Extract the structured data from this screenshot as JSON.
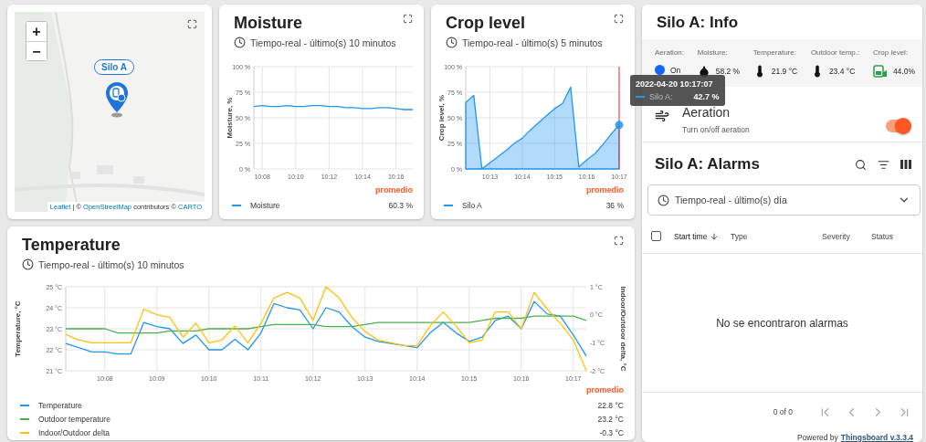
{
  "map": {
    "zoom_in": "+",
    "zoom_out": "−",
    "marker_label": "Silo A",
    "attribution": [
      {
        "text": "Leaflet",
        "link": true
      },
      {
        "text": " | © ",
        "link": false
      },
      {
        "text": "OpenStreetMap",
        "link": true
      },
      {
        "text": " contributors © ",
        "link": false
      },
      {
        "text": "CARTO",
        "link": true
      }
    ]
  },
  "moisture": {
    "title": "Moisture",
    "timewindow": "Tiempo-real - último(s) 10 minutos",
    "legend_header": "promedio",
    "chart_data": {
      "type": "line",
      "grid": true,
      "ylabel": "Moisture, %",
      "ylim": [
        0,
        100
      ],
      "categories": [
        null,
        "10:08",
        null,
        null,
        null,
        "10:10",
        null,
        null,
        null,
        "10:12",
        null,
        null,
        null,
        "10:14",
        null,
        null,
        null,
        "10:16",
        null,
        null
      ],
      "series": [
        {
          "name": "Moisture",
          "color": "#2196f3",
          "values": [
            61,
            62,
            61,
            61,
            62,
            61,
            61,
            62,
            62,
            61,
            61,
            60,
            60,
            59,
            59,
            60,
            60,
            59,
            58,
            58
          ]
        }
      ],
      "yticks": [
        {
          "value": 0,
          "label": "0 %"
        },
        {
          "value": 25,
          "label": "25 %"
        },
        {
          "value": 50,
          "label": "50 %"
        },
        {
          "value": 75,
          "label": "75 %"
        },
        {
          "value": 100,
          "label": "100 %"
        }
      ]
    },
    "legend": [
      {
        "value": "60.3 %"
      }
    ]
  },
  "crop": {
    "title": "Crop level",
    "timewindow": "Tiempo-real - último(s) 5 minutos",
    "legend_header": "promedio",
    "chart_data": {
      "type": "area",
      "grid": true,
      "ylabel": "Crop level, %",
      "ylim": [
        0,
        100
      ],
      "categories": [
        null,
        null,
        null,
        "10:13",
        null,
        null,
        null,
        "10:14",
        null,
        null,
        null,
        "10:15",
        null,
        null,
        null,
        "10:16",
        null,
        null,
        null,
        "10:17"
      ],
      "series": [
        {
          "name": "Silo A",
          "color": "#2196f3",
          "values": [
            65,
            72,
            0,
            6,
            12,
            18,
            25,
            30,
            38,
            45,
            52,
            59,
            64,
            80,
            2,
            9,
            15,
            24,
            34,
            43
          ]
        }
      ],
      "yticks": [
        {
          "value": 0,
          "label": "0 %"
        },
        {
          "value": 25,
          "label": "25 %"
        },
        {
          "value": 50,
          "label": "50 %"
        },
        {
          "value": 75,
          "label": "75 %"
        },
        {
          "value": 100,
          "label": "100 %"
        }
      ]
    },
    "tooltip": {
      "time": "2022-04-20 10:17:07",
      "series": "Silo A:",
      "value": "42.7 %",
      "color": "#2196f3"
    },
    "legend": [
      {
        "value": "36 %"
      }
    ]
  },
  "temperature": {
    "title": "Temperature",
    "timewindow": "Tiempo-real - último(s) 10 minutos",
    "legend_header": "promedio",
    "chart_data": {
      "type": "line",
      "grid": true,
      "ylabel": "Temperature, °C",
      "y2label": "Indoor/Outdoor delta, °C",
      "ylim": [
        21,
        25
      ],
      "y2lim": [
        -2,
        1
      ],
      "categories": [
        null,
        null,
        null,
        "10:08",
        null,
        null,
        null,
        "10:09",
        null,
        null,
        null,
        "10:10",
        null,
        null,
        null,
        "10:11",
        null,
        null,
        null,
        "10:12",
        null,
        null,
        null,
        "10:13",
        null,
        null,
        null,
        "10:14",
        null,
        null,
        null,
        "10:15",
        null,
        null,
        null,
        "10:16",
        null,
        null,
        null,
        "10:17",
        null
      ],
      "series": [
        {
          "name": "Temperature",
          "color": "#2196f3",
          "values": [
            22.3,
            22.1,
            21.9,
            21.9,
            21.8,
            21.8,
            23.3,
            23.1,
            23.0,
            22.3,
            22.7,
            22.0,
            22.0,
            22.5,
            22.0,
            22.8,
            24.2,
            24.0,
            23.9,
            23.0,
            24.0,
            23.8,
            23.1,
            22.6,
            22.4,
            22.3,
            22.2,
            22.1,
            22.8,
            23.3,
            22.8,
            22.4,
            22.6,
            23.4,
            23.6,
            23.0,
            24.3,
            23.7,
            23.6,
            22.7,
            21.7
          ]
        },
        {
          "name": "Outdoor temperature",
          "color": "#4caf50",
          "values": [
            23.0,
            23.0,
            23.0,
            23.0,
            22.8,
            22.8,
            22.8,
            22.8,
            22.9,
            22.9,
            22.9,
            23.0,
            23.0,
            23.0,
            23.0,
            23.1,
            23.2,
            23.2,
            23.2,
            23.2,
            23.1,
            23.1,
            23.1,
            23.2,
            23.3,
            23.3,
            23.3,
            23.3,
            23.3,
            23.3,
            23.3,
            23.3,
            23.4,
            23.5,
            23.5,
            23.5,
            23.6,
            23.6,
            23.6,
            23.6,
            23.4
          ]
        },
        {
          "name": "Indoor/Outdoor delta",
          "color": "#ffc107",
          "axis": "y2",
          "values": [
            -0.7,
            -0.9,
            -1.0,
            -1.0,
            -1.0,
            -1.0,
            0.2,
            0.0,
            -0.1,
            -0.8,
            -0.3,
            -1.0,
            -0.9,
            -0.4,
            -1.0,
            -0.3,
            0.6,
            0.8,
            0.6,
            -0.2,
            1.0,
            0.6,
            -0.1,
            -0.6,
            -0.9,
            -1.0,
            -1.1,
            -1.1,
            -0.4,
            0.1,
            -0.4,
            -1.0,
            -0.9,
            0.1,
            0.1,
            -0.5,
            0.8,
            0.2,
            -0.3,
            -0.9,
            -2.0
          ]
        }
      ],
      "yticks": [
        {
          "value": 21,
          "label": "21 °C"
        },
        {
          "value": 22,
          "label": "22 °C"
        },
        {
          "value": 23,
          "label": "23 °C"
        },
        {
          "value": 24,
          "label": "24 °C"
        },
        {
          "value": 25,
          "label": "25 °C"
        }
      ],
      "y2ticks": [
        {
          "value": -2,
          "label": "-2 °C"
        },
        {
          "value": -1,
          "label": "-1 °C"
        },
        {
          "value": 0,
          "label": "0 °C"
        },
        {
          "value": 1,
          "label": "1 °C"
        }
      ]
    },
    "legend": [
      {
        "value": "22.8 °C"
      },
      {
        "value": "23.2 °C"
      },
      {
        "value": "-0.3 °C"
      }
    ]
  },
  "info": {
    "title": "Silo A: Info",
    "items": [
      {
        "kind": "status",
        "label": "Aeration:",
        "value": "On",
        "on": true
      },
      {
        "kind": "moisture",
        "label": "Moisture:",
        "value": "58.2 %"
      },
      {
        "kind": "temperature",
        "label": "Temperature:",
        "value": "21.9 °C"
      },
      {
        "kind": "temperature",
        "label": "Outdoor temp.:",
        "value": "23.4 °C"
      },
      {
        "kind": "level",
        "label": "Crop level:",
        "value": "44.0%"
      }
    ],
    "control": {
      "title": "Aeration",
      "subtitle": "Turn on/off aeration",
      "on": true
    }
  },
  "alarms": {
    "title": "Silo A: Alarms",
    "timewindow": "Tiempo-real - último(s) día",
    "select_all_checked": false,
    "columns": [
      {
        "label": "Start time",
        "sorted": true
      },
      {
        "label": "Type",
        "sorted": false
      },
      {
        "label": "Severity",
        "sorted": false
      },
      {
        "label": "Status",
        "sorted": false
      }
    ],
    "empty_message": "No se encontraron alarmas",
    "page_info": "0 of 0",
    "pager_disabled": true
  },
  "footer": {
    "text": "Powered by",
    "link": "Thingsboard v.3.3.4"
  }
}
